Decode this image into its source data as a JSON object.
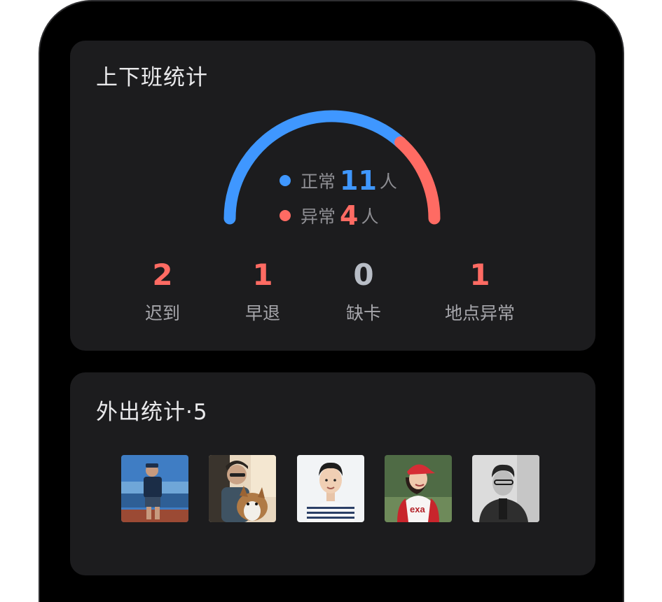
{
  "attendance": {
    "title": "上下班统计",
    "normal": {
      "label": "正常",
      "value": "11",
      "unit": "人",
      "color": "#3f97ff"
    },
    "abnormal": {
      "label": "异常",
      "value": "4",
      "unit": "人",
      "color": "#ff6b63"
    },
    "gauge_normal_fraction": 0.733,
    "stats": [
      {
        "value": "2",
        "label": "迟到",
        "color": "#ff6b63"
      },
      {
        "value": "1",
        "label": "早退",
        "color": "#ff6b63"
      },
      {
        "value": "0",
        "label": "缺卡",
        "color": "#b8bdc6"
      },
      {
        "value": "1",
        "label": "地点异常",
        "color": "#ff6b63"
      }
    ]
  },
  "outing": {
    "title": "外出统计·5",
    "avatars": [
      {
        "name": "avatar-1",
        "icon": "photo-person-seaside"
      },
      {
        "name": "avatar-2",
        "icon": "photo-person-with-dog"
      },
      {
        "name": "avatar-3",
        "icon": "photo-person-striped-shirt"
      },
      {
        "name": "avatar-4",
        "icon": "photo-person-red-cap"
      },
      {
        "name": "avatar-5",
        "icon": "photo-person-grayscale"
      }
    ]
  },
  "colors": {
    "background": "#000000",
    "card": "#1c1c1e",
    "normal": "#3f97ff",
    "abnormal": "#ff6b63"
  }
}
